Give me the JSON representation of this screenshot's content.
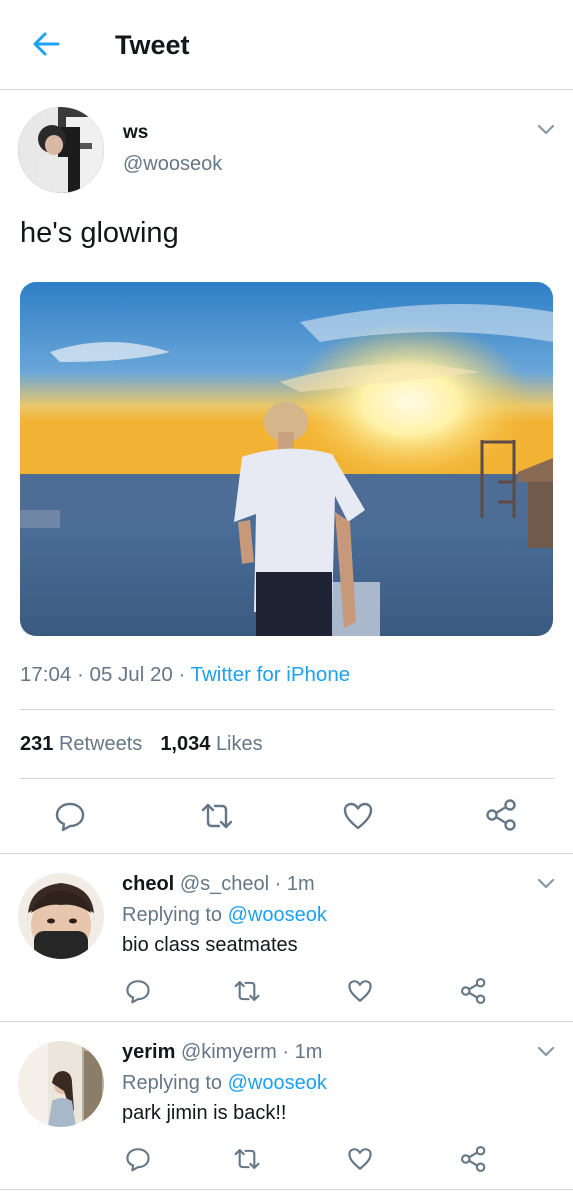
{
  "header": {
    "title": "Tweet",
    "back_icon": "arrow-left-icon"
  },
  "colors": {
    "accent": "#1da1f2",
    "secondary_text": "#657786",
    "divider": "#d0d6db"
  },
  "tweet": {
    "name": "ws",
    "handle": "@wooseok",
    "text": "he's glowing",
    "time": "17:04",
    "dot1": "·",
    "date": "05 Jul 20",
    "dot2": "·",
    "source": "Twitter for iPhone",
    "retweets_count": "231",
    "retweets_label": "Retweets",
    "likes_count": "1,034",
    "likes_label": "Likes",
    "actions": [
      "reply-icon",
      "retweet-icon",
      "like-icon",
      "share-icon"
    ]
  },
  "replies": [
    {
      "name": "cheol",
      "handle": "@s_cheol",
      "time": "· 1m",
      "replying_to_label": "Replying to",
      "mention": "@wooseok",
      "text": "bio class seatmates"
    },
    {
      "name": "yerim",
      "handle": "@kimyerm",
      "time": "· 1m",
      "replying_to_label": "Replying to",
      "mention": "@wooseok",
      "text": "park jimin is back!!"
    }
  ]
}
